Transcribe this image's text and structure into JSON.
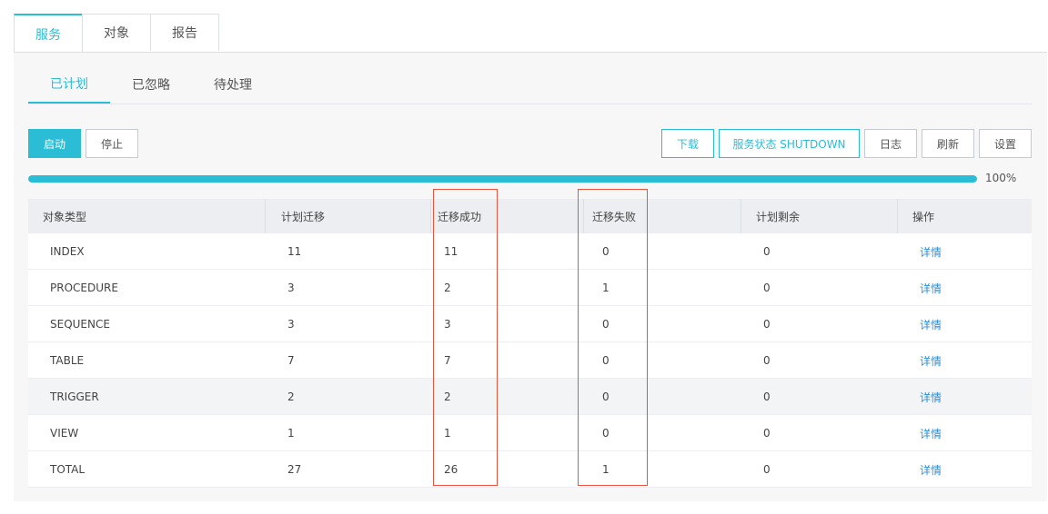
{
  "top_tabs": [
    "服务",
    "对象",
    "报告"
  ],
  "sub_tabs": [
    "已计划",
    "已忽略",
    "待处理"
  ],
  "toolbar": {
    "start": "启动",
    "stop": "停止",
    "download": "下载",
    "service_status": "服务状态 SHUTDOWN",
    "log": "日志",
    "refresh": "刷新",
    "settings": "设置"
  },
  "progress": {
    "percent": 100,
    "label": "100%"
  },
  "table": {
    "headers": [
      "对象类型",
      "计划迁移",
      "迁移成功",
      "迁移失败",
      "计划剩余",
      "操作"
    ],
    "rows": [
      {
        "type": "INDEX",
        "planned": "11",
        "success": "11",
        "failed": "0",
        "remaining": "0",
        "action": "详情"
      },
      {
        "type": "PROCEDURE",
        "planned": "3",
        "success": "2",
        "failed": "1",
        "remaining": "0",
        "action": "详情"
      },
      {
        "type": "SEQUENCE",
        "planned": "3",
        "success": "3",
        "failed": "0",
        "remaining": "0",
        "action": "详情"
      },
      {
        "type": "TABLE",
        "planned": "7",
        "success": "7",
        "failed": "0",
        "remaining": "0",
        "action": "详情"
      },
      {
        "type": "TRIGGER",
        "planned": "2",
        "success": "2",
        "failed": "0",
        "remaining": "0",
        "action": "详情"
      },
      {
        "type": "VIEW",
        "planned": "1",
        "success": "1",
        "failed": "0",
        "remaining": "0",
        "action": "详情"
      },
      {
        "type": "TOTAL",
        "planned": "27",
        "success": "26",
        "failed": "1",
        "remaining": "0",
        "action": "详情"
      }
    ]
  },
  "colors": {
    "accent": "#2bbcd6",
    "link": "#2b8fd6",
    "highlight_box": "#e8553e"
  }
}
